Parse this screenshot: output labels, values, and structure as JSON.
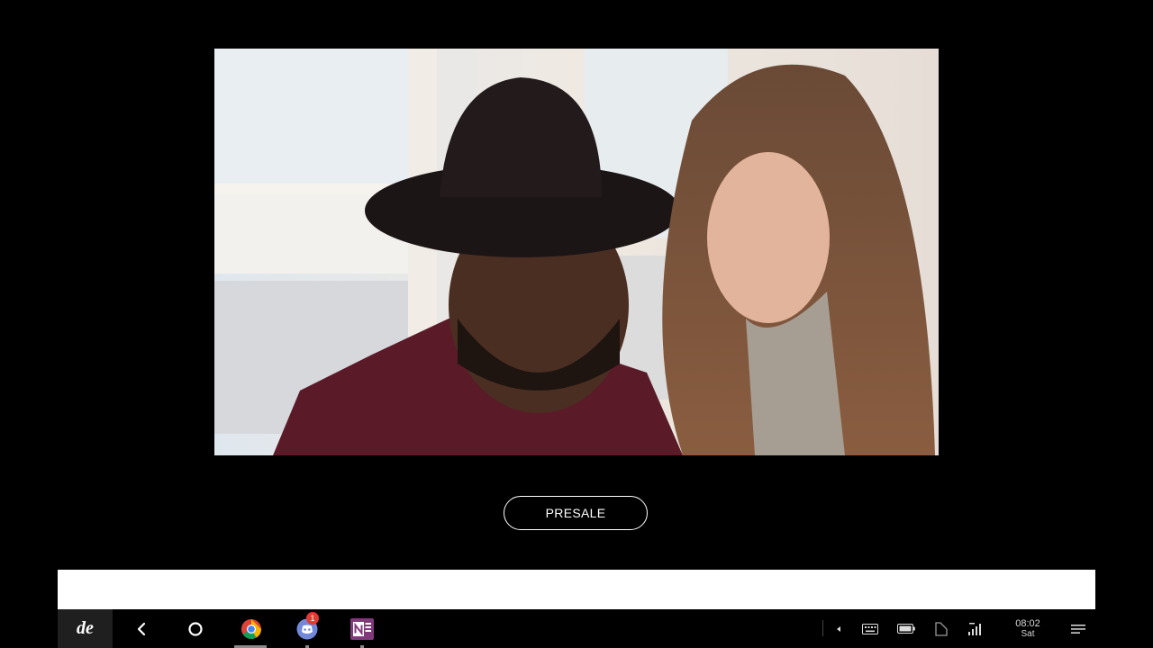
{
  "hero": {
    "description_icon": "photo-people-icon"
  },
  "presale_button": {
    "label": "PRESALE"
  },
  "taskbar": {
    "launcher_glyph": "de",
    "apps": [
      {
        "name": "chrome-icon"
      },
      {
        "name": "discord-icon",
        "badge": "1"
      },
      {
        "name": "onenote-icon"
      }
    ],
    "clock": {
      "time": "08:02",
      "day": "Sat"
    }
  }
}
